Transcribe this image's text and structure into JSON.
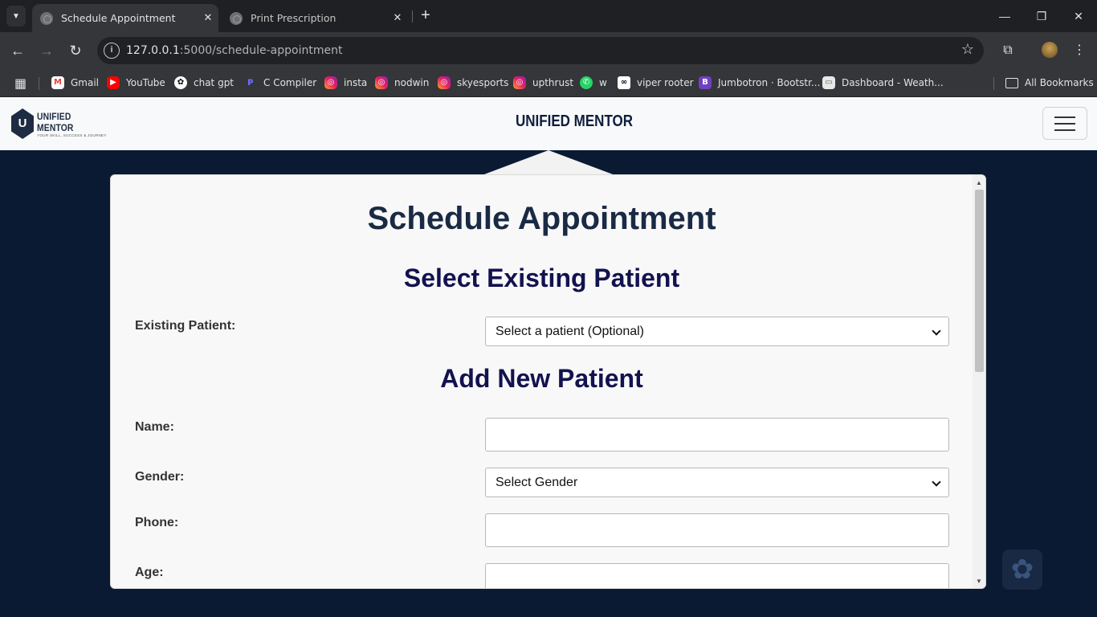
{
  "browser": {
    "tabs": [
      {
        "title": "Schedule Appointment",
        "active": true
      },
      {
        "title": "Print Prescription",
        "active": false
      }
    ],
    "url_host": "127.0.0.1",
    "url_path": ":5000/schedule-appointment",
    "bookmarks": [
      {
        "label": "Gmail",
        "icon": "gmail-icon",
        "glyph": "M"
      },
      {
        "label": "YouTube",
        "icon": "youtube-icon",
        "glyph": "▶"
      },
      {
        "label": "chat gpt",
        "icon": "chatgpt-icon",
        "glyph": "✿"
      },
      {
        "label": "C Compiler",
        "icon": "compiler-icon",
        "glyph": "ᴘ"
      },
      {
        "label": "insta",
        "icon": "instagram-icon",
        "glyph": "◎"
      },
      {
        "label": "nodwin",
        "icon": "instagram-icon",
        "glyph": "◎"
      },
      {
        "label": "skyesports",
        "icon": "instagram-icon",
        "glyph": "◎"
      },
      {
        "label": "upthrust",
        "icon": "instagram-icon",
        "glyph": "◎"
      },
      {
        "label": "w",
        "icon": "whatsapp-icon",
        "glyph": "✆"
      },
      {
        "label": "viper rooter",
        "icon": "viper-icon",
        "glyph": "∞"
      },
      {
        "label": "Jumbotron · Bootstr...",
        "icon": "bootstrap-icon",
        "glyph": "B"
      },
      {
        "label": "Dashboard - Weath...",
        "icon": "dashboard-icon",
        "glyph": "▭"
      }
    ],
    "all_bookmarks": "All Bookmarks"
  },
  "site": {
    "logo_name": "UNIFIED MENTOR",
    "logo_tagline": "YOUR SKILL, SUCCESS & JOURNEY",
    "brand": "UNIFIED MENTOR"
  },
  "form": {
    "title": "Schedule Appointment",
    "existing_heading": "Select Existing Patient",
    "existing_label": "Existing Patient:",
    "existing_value": "Select a patient (Optional)",
    "new_heading": "Add New Patient",
    "name_label": "Name:",
    "name_value": "",
    "gender_label": "Gender:",
    "gender_value": "Select Gender",
    "phone_label": "Phone:",
    "phone_value": "",
    "age_label": "Age:",
    "age_value": ""
  }
}
